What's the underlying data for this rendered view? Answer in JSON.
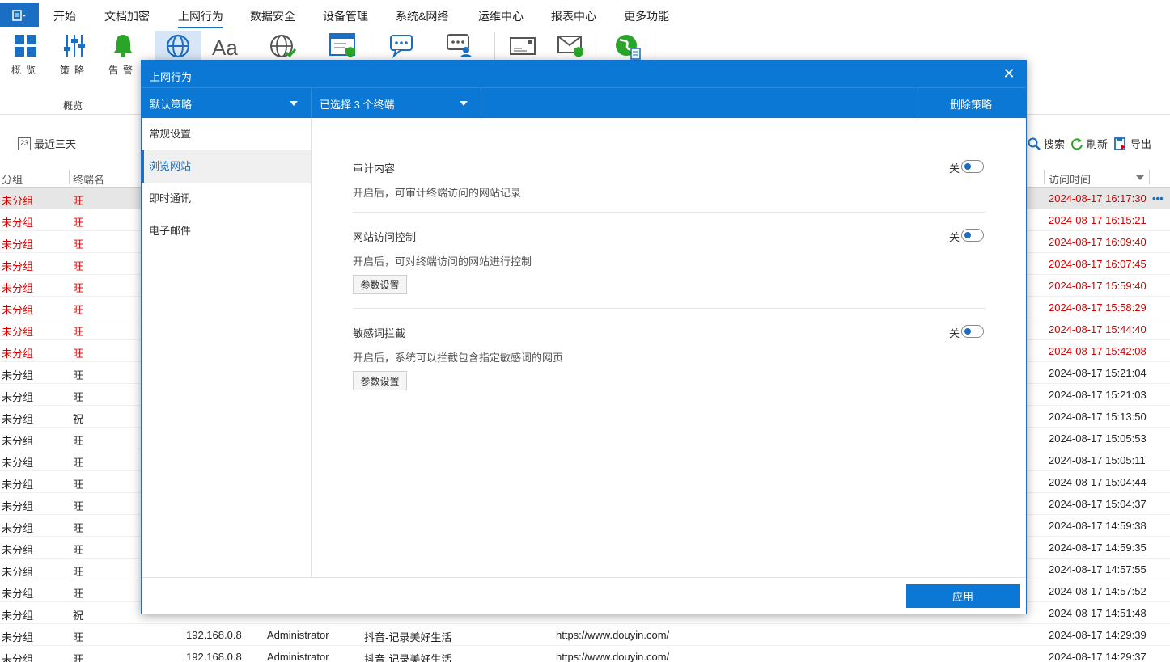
{
  "menu": {
    "app_icon": "menu-list-icon",
    "items": [
      "开始",
      "文档加密",
      "上网行为",
      "数据安全",
      "设备管理",
      "系统&网络",
      "运维中心",
      "报表中心",
      "更多功能"
    ]
  },
  "ribbon": {
    "items": [
      {
        "label": "概览",
        "icon": "overview-grid-icon"
      },
      {
        "label": "策略",
        "icon": "policy-sliders-icon"
      },
      {
        "label": "告警",
        "icon": "alarm-bell-icon"
      }
    ],
    "group_label": "概览"
  },
  "toolbar": {
    "date_filter": "最近三天",
    "calendar_day": "23",
    "search": "搜索",
    "refresh": "刷新",
    "export": "导出"
  },
  "table": {
    "headers": {
      "group": "分组",
      "terminal": "终端名",
      "visit_time": "访问时间"
    },
    "rows": [
      {
        "group": "未分组",
        "name": "旺",
        "ip": "",
        "user": "",
        "title": "",
        "url": "",
        "time": "2024-08-17 16:17:30",
        "red": true
      },
      {
        "group": "未分组",
        "name": "旺",
        "ip": "",
        "user": "",
        "title": "",
        "url": "",
        "time": "2024-08-17 16:15:21",
        "red": true
      },
      {
        "group": "未分组",
        "name": "旺",
        "ip": "",
        "user": "",
        "title": "",
        "url": "",
        "time": "2024-08-17 16:09:40",
        "red": true
      },
      {
        "group": "未分组",
        "name": "旺",
        "ip": "",
        "user": "",
        "title": "",
        "url": "",
        "time": "2024-08-17 16:07:45",
        "red": true
      },
      {
        "group": "未分组",
        "name": "旺",
        "ip": "",
        "user": "",
        "title": "",
        "url": "",
        "time": "2024-08-17 15:59:40",
        "red": true
      },
      {
        "group": "未分组",
        "name": "旺",
        "ip": "",
        "user": "",
        "title": "",
        "url": "",
        "time": "2024-08-17 15:58:29",
        "red": true
      },
      {
        "group": "未分组",
        "name": "旺",
        "ip": "",
        "user": "",
        "title": "",
        "url": "",
        "time": "2024-08-17 15:44:40",
        "red": true
      },
      {
        "group": "未分组",
        "name": "旺",
        "ip": "",
        "user": "",
        "title": "",
        "url": "",
        "time": "2024-08-17 15:42:08",
        "red": true
      },
      {
        "group": "未分组",
        "name": "旺",
        "ip": "",
        "user": "",
        "title": "",
        "url": "",
        "time": "2024-08-17 15:21:04",
        "red": false
      },
      {
        "group": "未分组",
        "name": "旺",
        "ip": "",
        "user": "",
        "title": "",
        "url": "",
        "time": "2024-08-17 15:21:03",
        "red": false
      },
      {
        "group": "未分组",
        "name": "祝",
        "ip": "",
        "user": "",
        "title": "",
        "url": "",
        "time": "2024-08-17 15:13:50",
        "red": false
      },
      {
        "group": "未分组",
        "name": "旺",
        "ip": "",
        "user": "",
        "title": "",
        "url": "",
        "time": "2024-08-17 15:05:53",
        "red": false
      },
      {
        "group": "未分组",
        "name": "旺",
        "ip": "",
        "user": "",
        "title": "",
        "url": "",
        "time": "2024-08-17 15:05:11",
        "red": false
      },
      {
        "group": "未分组",
        "name": "旺",
        "ip": "",
        "user": "",
        "title": "",
        "url": "",
        "time": "2024-08-17 15:04:44",
        "red": false
      },
      {
        "group": "未分组",
        "name": "旺",
        "ip": "",
        "user": "",
        "title": "",
        "url": "",
        "time": "2024-08-17 15:04:37",
        "red": false
      },
      {
        "group": "未分组",
        "name": "旺",
        "ip": "",
        "user": "",
        "title": "",
        "url": "",
        "time": "2024-08-17 14:59:38",
        "red": false
      },
      {
        "group": "未分组",
        "name": "旺",
        "ip": "",
        "user": "",
        "title": "",
        "url": "",
        "time": "2024-08-17 14:59:35",
        "red": false
      },
      {
        "group": "未分组",
        "name": "旺",
        "ip": "",
        "user": "",
        "title": "",
        "url": "",
        "time": "2024-08-17 14:57:55",
        "red": false
      },
      {
        "group": "未分组",
        "name": "旺",
        "ip": "",
        "user": "",
        "title": "",
        "url": "",
        "time": "2024-08-17 14:57:52",
        "red": false
      },
      {
        "group": "未分组",
        "name": "祝",
        "ip": "",
        "user": "",
        "title": "",
        "url": "",
        "time": "2024-08-17 14:51:48",
        "red": false
      },
      {
        "group": "未分组",
        "name": "旺",
        "ip": "192.168.0.8",
        "user": "Administrator",
        "title": "抖音-记录美好生活",
        "url": "https://www.douyin.com/",
        "time": "2024-08-17 14:29:39",
        "red": false
      },
      {
        "group": "未分组",
        "name": "旺",
        "ip": "192.168.0.8",
        "user": "Administrator",
        "title": "抖音-记录美好生活",
        "url": "https://www.douyin.com/",
        "time": "2024-08-17 14:29:37",
        "red": false
      }
    ]
  },
  "modal": {
    "title": "上网行为",
    "policy_select": "默认策略",
    "terminal_select": "已选择 3 个终端",
    "delete_policy": "删除策略",
    "nav": [
      "常规设置",
      "浏览网站",
      "即时通讯",
      "电子邮件"
    ],
    "active_nav": 1,
    "settings": [
      {
        "title": "审计内容",
        "desc": "开启后，可审计终端访问的网站记录",
        "state": "关",
        "param": ""
      },
      {
        "title": "网站访问控制",
        "desc": "开启后，可对终端访问的网站进行控制",
        "state": "关",
        "param": "参数设置"
      },
      {
        "title": "敏感词拦截",
        "desc": "开启后，系统可以拦截包含指定敏感词的网页",
        "state": "关",
        "param": "参数设置"
      }
    ],
    "apply": "应用"
  },
  "colors": {
    "accent": "#0b78d6",
    "alert_red": "#d10000"
  }
}
